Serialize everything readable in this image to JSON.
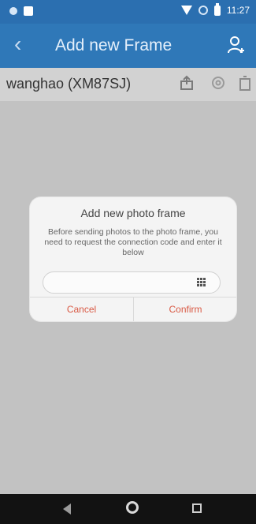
{
  "status_bar": {
    "time": "11:27"
  },
  "app_bar": {
    "title": "Add new Frame",
    "back_icon": "back-arrow-icon",
    "add_icon": "add-user-icon"
  },
  "frame_bar": {
    "name": "wanghao (XM87SJ)"
  },
  "dialog": {
    "title": "Add new photo frame",
    "message": "Before sending photos to the photo frame, you need to request the connection code and enter it below",
    "input_value": "",
    "input_placeholder": "",
    "cancel_label": "Cancel",
    "confirm_label": "Confirm"
  },
  "colors": {
    "primary": "#2f78b8",
    "accent": "#d95a45"
  }
}
